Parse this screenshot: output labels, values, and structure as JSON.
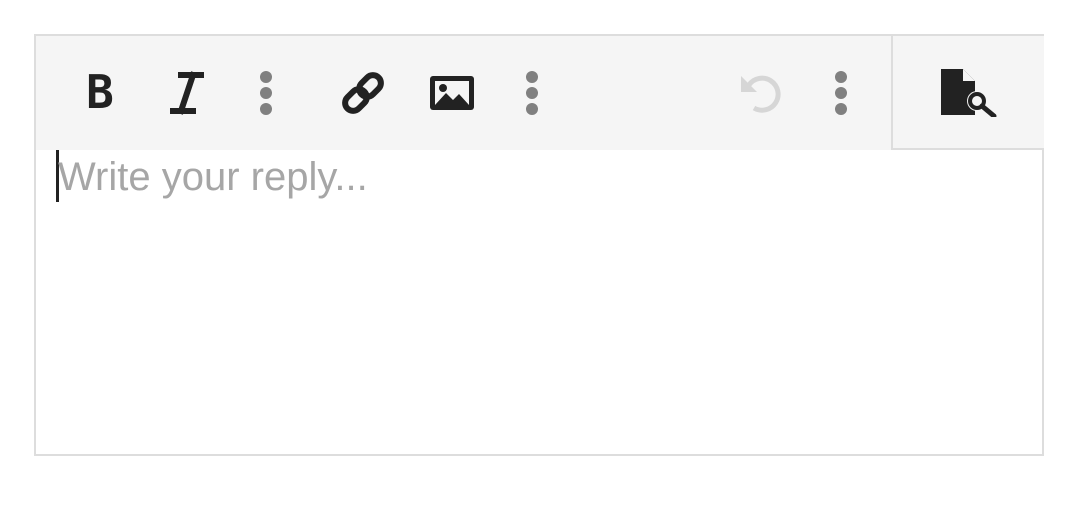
{
  "composer": {
    "placeholder": "Write your reply...",
    "text": ""
  },
  "toolbar": {
    "buttons": [
      {
        "name": "bold",
        "icon": "bold-icon",
        "enabled": true
      },
      {
        "name": "italic",
        "icon": "italic-icon",
        "enabled": true
      },
      {
        "name": "more-formatting",
        "icon": "vertical-ellipsis-icon",
        "enabled": true
      },
      {
        "name": "insert-link",
        "icon": "link-icon",
        "enabled": true
      },
      {
        "name": "insert-image",
        "icon": "image-icon",
        "enabled": true
      },
      {
        "name": "more-insert",
        "icon": "vertical-ellipsis-icon",
        "enabled": true
      },
      {
        "name": "undo",
        "icon": "undo-icon",
        "enabled": false
      },
      {
        "name": "more-actions",
        "icon": "vertical-ellipsis-icon",
        "enabled": true
      }
    ],
    "preview": {
      "icon": "document-preview-icon"
    }
  },
  "colors": {
    "toolbar_bg": "#f5f5f5",
    "icon": "#222222",
    "icon_muted": "#808080",
    "icon_disabled": "#d6d6d6",
    "border": "#dddddd",
    "placeholder": "#a6a6a6"
  }
}
